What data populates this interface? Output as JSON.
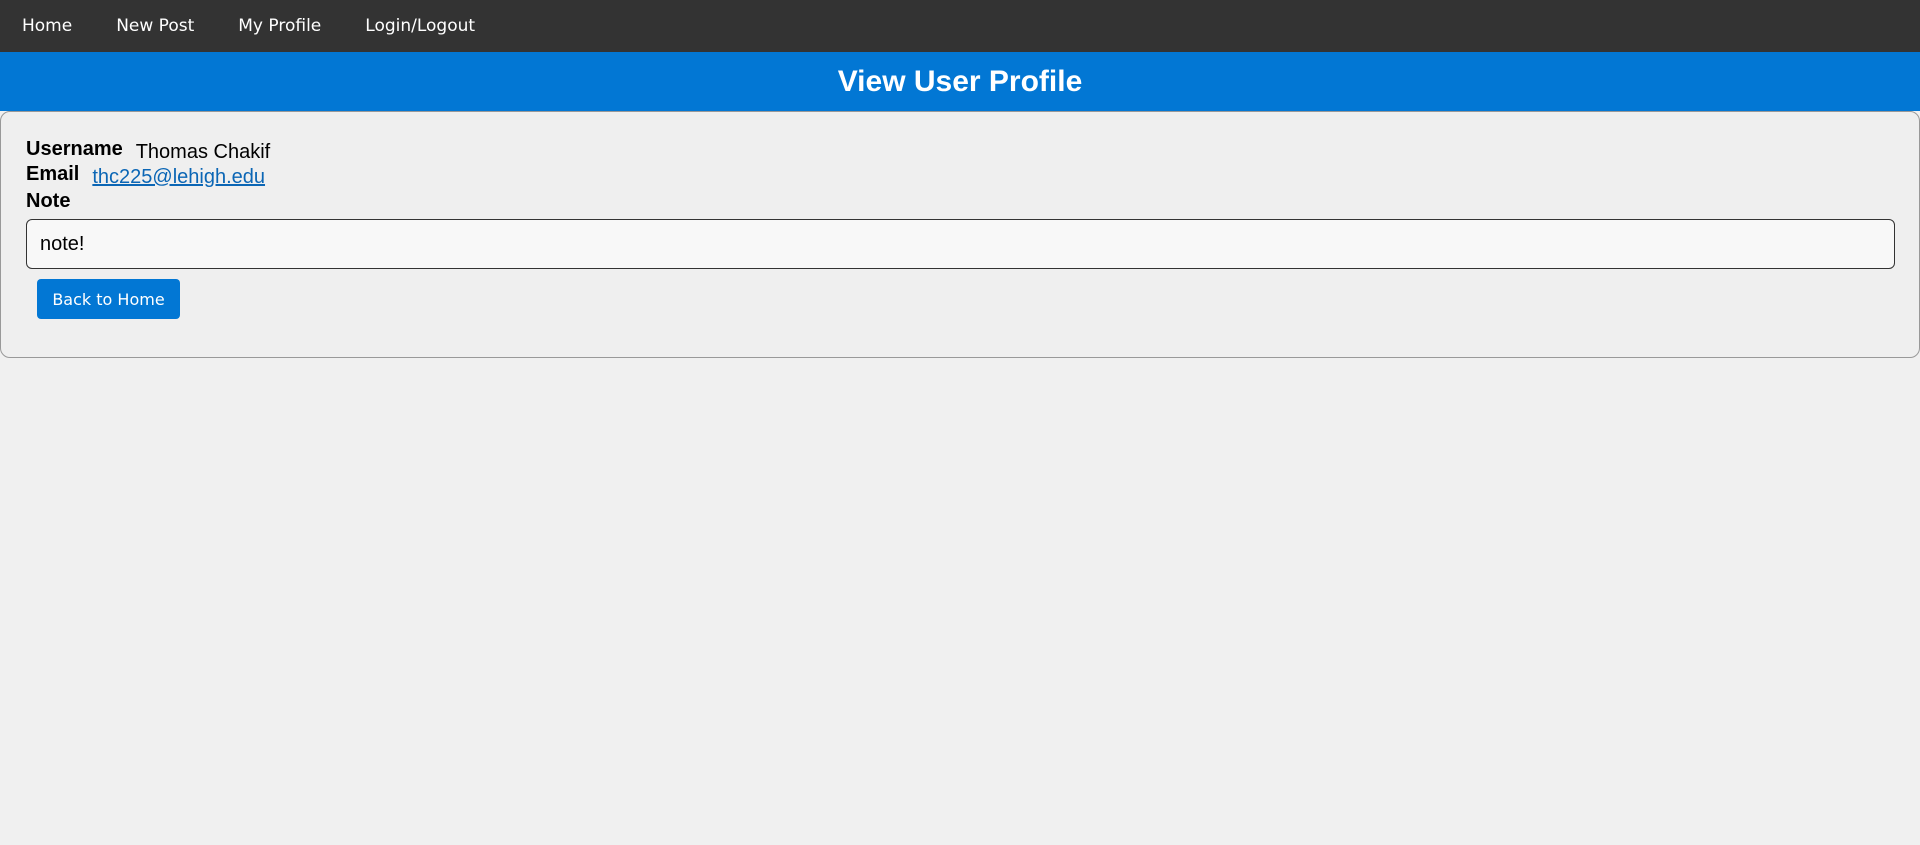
{
  "nav": {
    "items": [
      {
        "label": "Home"
      },
      {
        "label": "New Post"
      },
      {
        "label": "My Profile"
      },
      {
        "label": "Login/Logout"
      }
    ]
  },
  "banner": {
    "title": "View User Profile"
  },
  "profile": {
    "username_label": "Username",
    "username": "Thomas Chakif",
    "email_label": "Email",
    "email": "thc225@lehigh.edu",
    "note_label": "Note",
    "note": "note!",
    "back_button": "Back to Home"
  },
  "colors": {
    "nav_bg": "#333333",
    "accent": "#0277d4",
    "link": "#0b66b5",
    "page_bg": "#f0f0f0"
  }
}
